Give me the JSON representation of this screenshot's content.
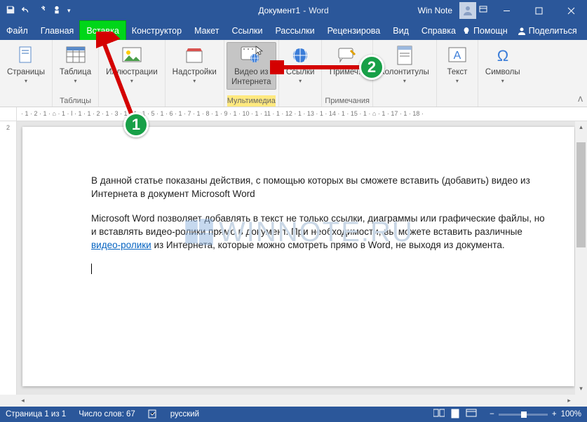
{
  "titlebar": {
    "doc": "Документ1",
    "sep": " - ",
    "app": "Word",
    "note": "Win Note"
  },
  "tabs": {
    "file": "Файл",
    "home": "Главная",
    "insert": "Вставка",
    "design": "Конструктор",
    "layout": "Макет",
    "references": "Ссылки",
    "mailings": "Рассылки",
    "review": "Рецензирова",
    "view": "Вид",
    "help": "Справка"
  },
  "right_cmds": {
    "help": "Помощн",
    "share": "Поделиться"
  },
  "ribbon": {
    "pages": "Страницы",
    "tables_btn": "Таблица",
    "tables_grp": "Таблицы",
    "illustrations": "Иллюстрации",
    "addins": "Надстройки",
    "video": "Видео из\nИнтернета",
    "multimedia": "Мультимедиа",
    "links": "Ссылки",
    "comment": "Примеч...",
    "comments_grp": "Примечания",
    "headerfooter": "Колонтитулы",
    "text": "Текст",
    "symbols": "Символы"
  },
  "ruler_h": "· 1 · 2 · 1 · ⌂ · 1 · ⅼ · 1 · 1 · 2 · 1 · 3 · 1 · 4 · 1 · 5 · 1 · 6 · 1 · 7 · 1 · 8 · 1 · 9 · 1 · 10 · 1 · 11 · 1 · 12 · 1 · 13 · 1 · 14 · 1 · 15 · 1 · ⌂ · 1 · 17 · 1 · 18 ·",
  "ruler_v_top": "2",
  "doc": {
    "p1": "В данной статье показаны действия, с помощью которых вы сможете вставить (добавить) видео из Интернета в документ Microsoft Word",
    "p2a": "Microsoft Word позволяет добавлять в текст не только ссылки, диаграммы или графические файлы, но и вставлять видео-ролики прямо в документ. При необходимости, вы можете вставить различные ",
    "p2link": "видео-ролики",
    "p2b": " из Интернета, которые можно смотреть прямо в Word, не выходя из документа."
  },
  "watermark": "WINNOTE.RU",
  "status": {
    "page": "Страница 1 из 1",
    "words": "Число слов: 67",
    "lang": "русский",
    "zoom": "100%"
  },
  "annotations": {
    "badge1": "1",
    "badge2": "2"
  }
}
